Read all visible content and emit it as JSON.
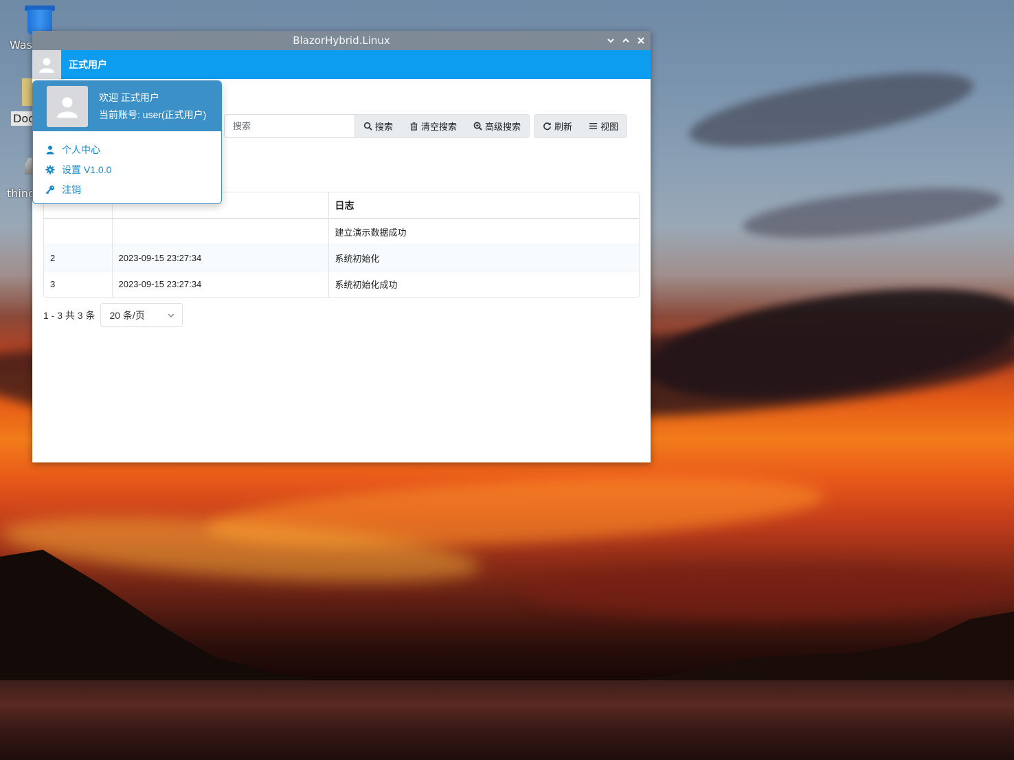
{
  "desktop": {
    "icons": [
      {
        "label": "Wast"
      },
      {
        "label": "Doc"
      },
      {
        "label": "thinc"
      }
    ]
  },
  "window": {
    "title": "BlazorHybrid.Linux"
  },
  "appbar": {
    "user_name": "正式用户"
  },
  "user_menu": {
    "welcome": "欢迎 正式用户",
    "account": "当前账号: user(正式用户)",
    "items": [
      {
        "label": "个人中心",
        "icon": "user-icon"
      },
      {
        "label": "设置 V1.0.0",
        "icon": "gear-icon"
      },
      {
        "label": "注销",
        "icon": "key-icon"
      }
    ]
  },
  "toolbar": {
    "search_placeholder": "搜索",
    "search_label": "搜索",
    "clear_label": "清空搜索",
    "advanced_label": "高级搜索",
    "refresh_label": "刷新",
    "view_label": "视图"
  },
  "table": {
    "columns": [
      "",
      "",
      "日志"
    ],
    "rows": [
      {
        "id": "",
        "time": "",
        "log": "建立演示数据成功"
      },
      {
        "id": "2",
        "time": "2023-09-15 23:27:34",
        "log": "系统初始化"
      },
      {
        "id": "3",
        "time": "2023-09-15 23:27:34",
        "log": "系统初始化成功"
      }
    ]
  },
  "pager": {
    "summary": "1 - 3 共 3 条",
    "page_size": "20 条/页"
  },
  "colors": {
    "appbar": "#0c9cf0",
    "titlebar": "#7e8b97",
    "menu_header": "#3b91c7",
    "link": "#1689c8"
  }
}
